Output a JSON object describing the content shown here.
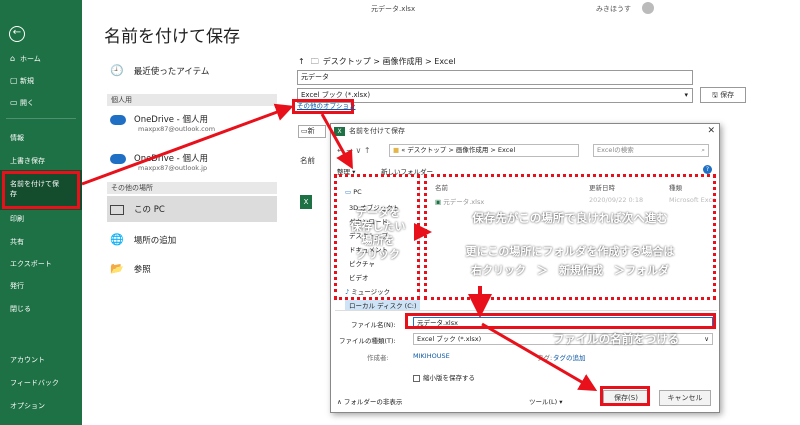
{
  "nav": {
    "back_icon": "arrow-left-icon",
    "items": [
      {
        "label": "ホーム",
        "icon": "home-icon"
      },
      {
        "label": "新規",
        "icon": "new-file-icon"
      },
      {
        "label": "開く",
        "icon": "folder-open-icon"
      },
      {
        "label": "情報"
      },
      {
        "label": "上書き保存"
      },
      {
        "label": "名前を付けて保\n存"
      },
      {
        "label": "印刷"
      },
      {
        "label": "共有"
      },
      {
        "label": "エクスポート"
      },
      {
        "label": "発行"
      },
      {
        "label": "閉じる"
      },
      {
        "label": "アカウント"
      },
      {
        "label": "フィードバック"
      },
      {
        "label": "オプション"
      }
    ]
  },
  "page_title": "名前を付けて保存",
  "window_title": "元データ.xlsx",
  "user_name": "みきほうす",
  "locations": {
    "recent": "最近使ったアイテム",
    "group_personal": "個人用",
    "onedrive1": {
      "name": "OneDrive - 個人用",
      "email": "maxpx87@outlook.com"
    },
    "onedrive2": {
      "name": "OneDrive - 個人用",
      "email": "maxpx87@outlook.jp"
    },
    "group_other": "その他の場所",
    "this_pc": "この PC",
    "add_place": "場所の追加",
    "browse": "参照"
  },
  "save_pane": {
    "breadcrumb": "デスクトップ > 画像作成用 > Excel",
    "filename": "元データ",
    "filetype": "Excel ブック (*.xlsx)",
    "save_label": "保存",
    "more_options": "その他のオプション",
    "new_folder": "新",
    "name_header": "名前"
  },
  "dialog": {
    "title": "名前を付けて保存",
    "path": "« デスクトップ > 画像作成用 > Excel",
    "search_placeholder": "Excelの検索",
    "organize": "整理 ▾",
    "new_folder": "新しいフォルダー",
    "col_name": "名前",
    "col_date": "更新日時",
    "col_type": "種類",
    "file_row": {
      "name": "元データ.xlsx",
      "date": "2020/09/22 0:18",
      "type": "Microsoft Exce"
    },
    "tree": [
      "PC",
      "3D オブジェクト",
      "ダウンロード",
      "デスクトップ",
      "ドキュメント",
      "ピクチャ",
      "ビデオ",
      "ミュージック",
      "ローカル ディスク (C:)"
    ],
    "filename_label": "ファイル名(N):",
    "filename_value": "元データ.xlsx",
    "filetype_label": "ファイルの種類(T):",
    "filetype_value": "Excel ブック (*.xlsx)",
    "author_label": "作成者:",
    "author_value": "MIKIHOUSE",
    "tag_label": "タグ:",
    "tag_value": "タグの追加",
    "thumbnail_label": "縮小版を保存する",
    "hide_folders": "フォルダーの非表示",
    "tools": "ツール(L)",
    "save": "保存(S)",
    "cancel": "キャンセル"
  },
  "annotations": {
    "left_callout": "データを\n保存したい\n場所を\nクリック",
    "main_line1": "保存先がこの場所で良ければ次へ進む",
    "main_line2": "更にこの場所にフォルダを作成する場合は",
    "main_line3": "右クリック　＞　新規作成　＞フォルダ",
    "filename_callout": "ファイルの名前をつける"
  },
  "colors": {
    "excel_green": "#1e7145",
    "annotation_red": "#e8101a",
    "link_blue": "#0b57a6"
  }
}
